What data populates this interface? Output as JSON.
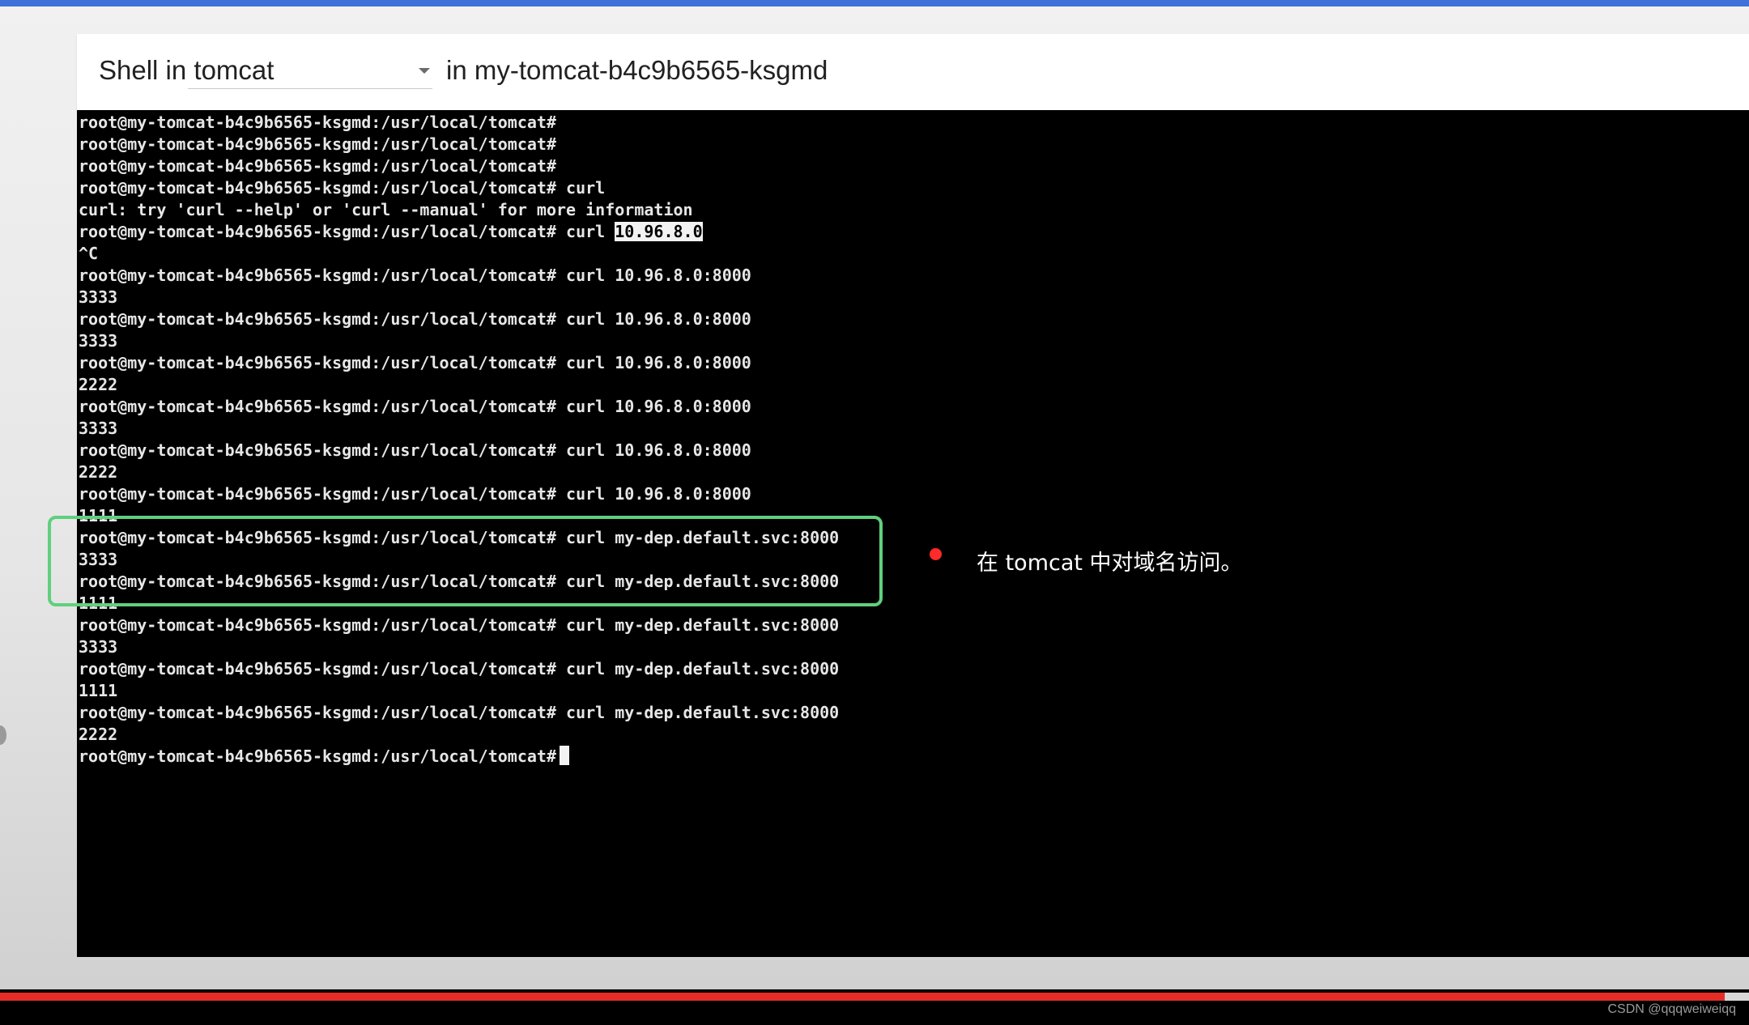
{
  "header": {
    "container_select": {
      "value": "Shell in tomcat"
    },
    "pod_label": "in my-tomcat-b4c9b6565-ksgmd"
  },
  "terminal": {
    "lines": [
      {
        "text": "root@my-tomcat-b4c9b6565-ksgmd:/usr/local/tomcat#"
      },
      {
        "text": "root@my-tomcat-b4c9b6565-ksgmd:/usr/local/tomcat#"
      },
      {
        "text": "root@my-tomcat-b4c9b6565-ksgmd:/usr/local/tomcat#"
      },
      {
        "text": "root@my-tomcat-b4c9b6565-ksgmd:/usr/local/tomcat# curl"
      },
      {
        "text": "curl: try 'curl --help' or 'curl --manual' for more information"
      },
      {
        "text": "root@my-tomcat-b4c9b6565-ksgmd:/usr/local/tomcat# curl ",
        "selected": "10.96.8.0"
      },
      {
        "text": "^C"
      },
      {
        "text": "root@my-tomcat-b4c9b6565-ksgmd:/usr/local/tomcat# curl 10.96.8.0:8000"
      },
      {
        "text": "3333"
      },
      {
        "text": "root@my-tomcat-b4c9b6565-ksgmd:/usr/local/tomcat# curl 10.96.8.0:8000"
      },
      {
        "text": "3333"
      },
      {
        "text": "root@my-tomcat-b4c9b6565-ksgmd:/usr/local/tomcat# curl 10.96.8.0:8000"
      },
      {
        "text": "2222"
      },
      {
        "text": "root@my-tomcat-b4c9b6565-ksgmd:/usr/local/tomcat# curl 10.96.8.0:8000"
      },
      {
        "text": "3333"
      },
      {
        "text": "root@my-tomcat-b4c9b6565-ksgmd:/usr/local/tomcat# curl 10.96.8.0:8000"
      },
      {
        "text": "2222"
      },
      {
        "text": "root@my-tomcat-b4c9b6565-ksgmd:/usr/local/tomcat# curl 10.96.8.0:8000"
      },
      {
        "text": "1111"
      },
      {
        "text": "root@my-tomcat-b4c9b6565-ksgmd:/usr/local/tomcat# curl my-dep.default.svc:8000"
      },
      {
        "text": "3333"
      },
      {
        "text": "root@my-tomcat-b4c9b6565-ksgmd:/usr/local/tomcat# curl my-dep.default.svc:8000"
      },
      {
        "text": "1111"
      },
      {
        "text": "root@my-tomcat-b4c9b6565-ksgmd:/usr/local/tomcat# curl my-dep.default.svc:8000"
      },
      {
        "text": "3333"
      },
      {
        "text": "root@my-tomcat-b4c9b6565-ksgmd:/usr/local/tomcat# curl my-dep.default.svc:8000"
      },
      {
        "text": "1111"
      },
      {
        "text": "root@my-tomcat-b4c9b6565-ksgmd:/usr/local/tomcat# curl my-dep.default.svc:8000"
      },
      {
        "text": "2222"
      },
      {
        "text": "root@my-tomcat-b4c9b6565-ksgmd:/usr/local/tomcat#",
        "cursor": true
      }
    ]
  },
  "annotation": {
    "text": "在 tomcat 中对域名访问。"
  },
  "video": {
    "progress_fraction": 0.986
  },
  "watermark": "CSDN @qqqweiweiqq",
  "colors": {
    "top_bar": "#3f6fd8",
    "terminal_bg": "#000000",
    "terminal_text": "#e6e6e6",
    "highlight_box": "#5fd07d",
    "annotation_dot": "#ff2a2a",
    "progress": "#e52d27"
  },
  "icons": {
    "dropdown": "caret-down-icon",
    "cursor": "terminal-cursor",
    "bullet": "bullet-dot-icon"
  }
}
